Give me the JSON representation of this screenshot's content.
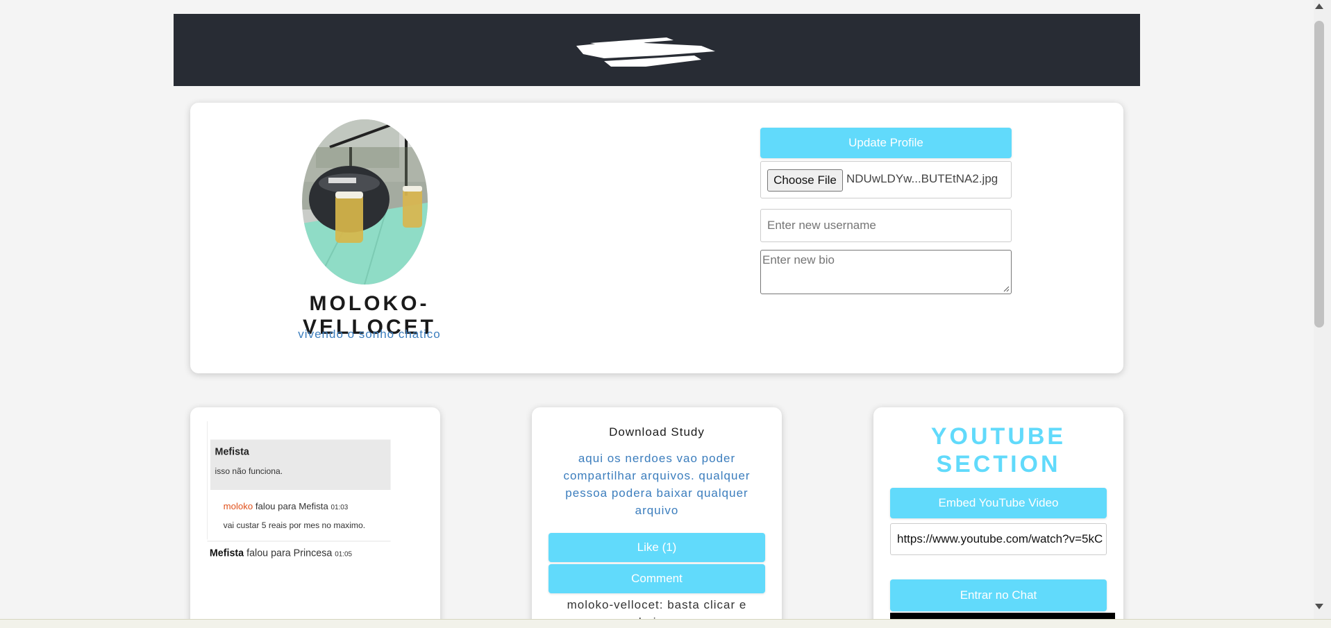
{
  "profile": {
    "username": "MOLOKO-VELLOCET",
    "bio": "vivendo o sonho chatico",
    "update_button": "Update Profile",
    "choose_file_button": "Choose File",
    "selected_file": "NDUwLDYw...BUTEtNA2.jpg",
    "username_placeholder": "Enter new username",
    "bio_placeholder": "Enter new bio"
  },
  "chat_preview": {
    "msg1_sender": "Mefista",
    "msg1_text": "isso não funciona.",
    "msg2_sender": "moloko",
    "msg2_verb": " falou para Mefista ",
    "msg2_time": "01:03",
    "msg2_text": "vai custar 5 reais por mes no maximo.",
    "msg3_sender": "Mefista",
    "msg3_verb": " falou para Princesa ",
    "msg3_time": "01:05"
  },
  "study": {
    "title": "Download Study",
    "description": "aqui os nerdoes vao poder compartilhar arquivos. qualquer pessoa podera baixar qualquer arquivo",
    "like_button": "Like (1)",
    "comment_button": "Comment",
    "first_comment": "moloko-vellocet: basta clicar e baixar"
  },
  "youtube": {
    "title": "YOUTUBE SECTION",
    "embed_button": "Embed YouTube Video",
    "url_value": "https://www.youtube.com/watch?v=5kC",
    "chat_button": "Entrar no Chat"
  },
  "colors": {
    "accent": "#61dafb",
    "header_bg": "#282c34",
    "link_blue": "#3b7dbd"
  }
}
